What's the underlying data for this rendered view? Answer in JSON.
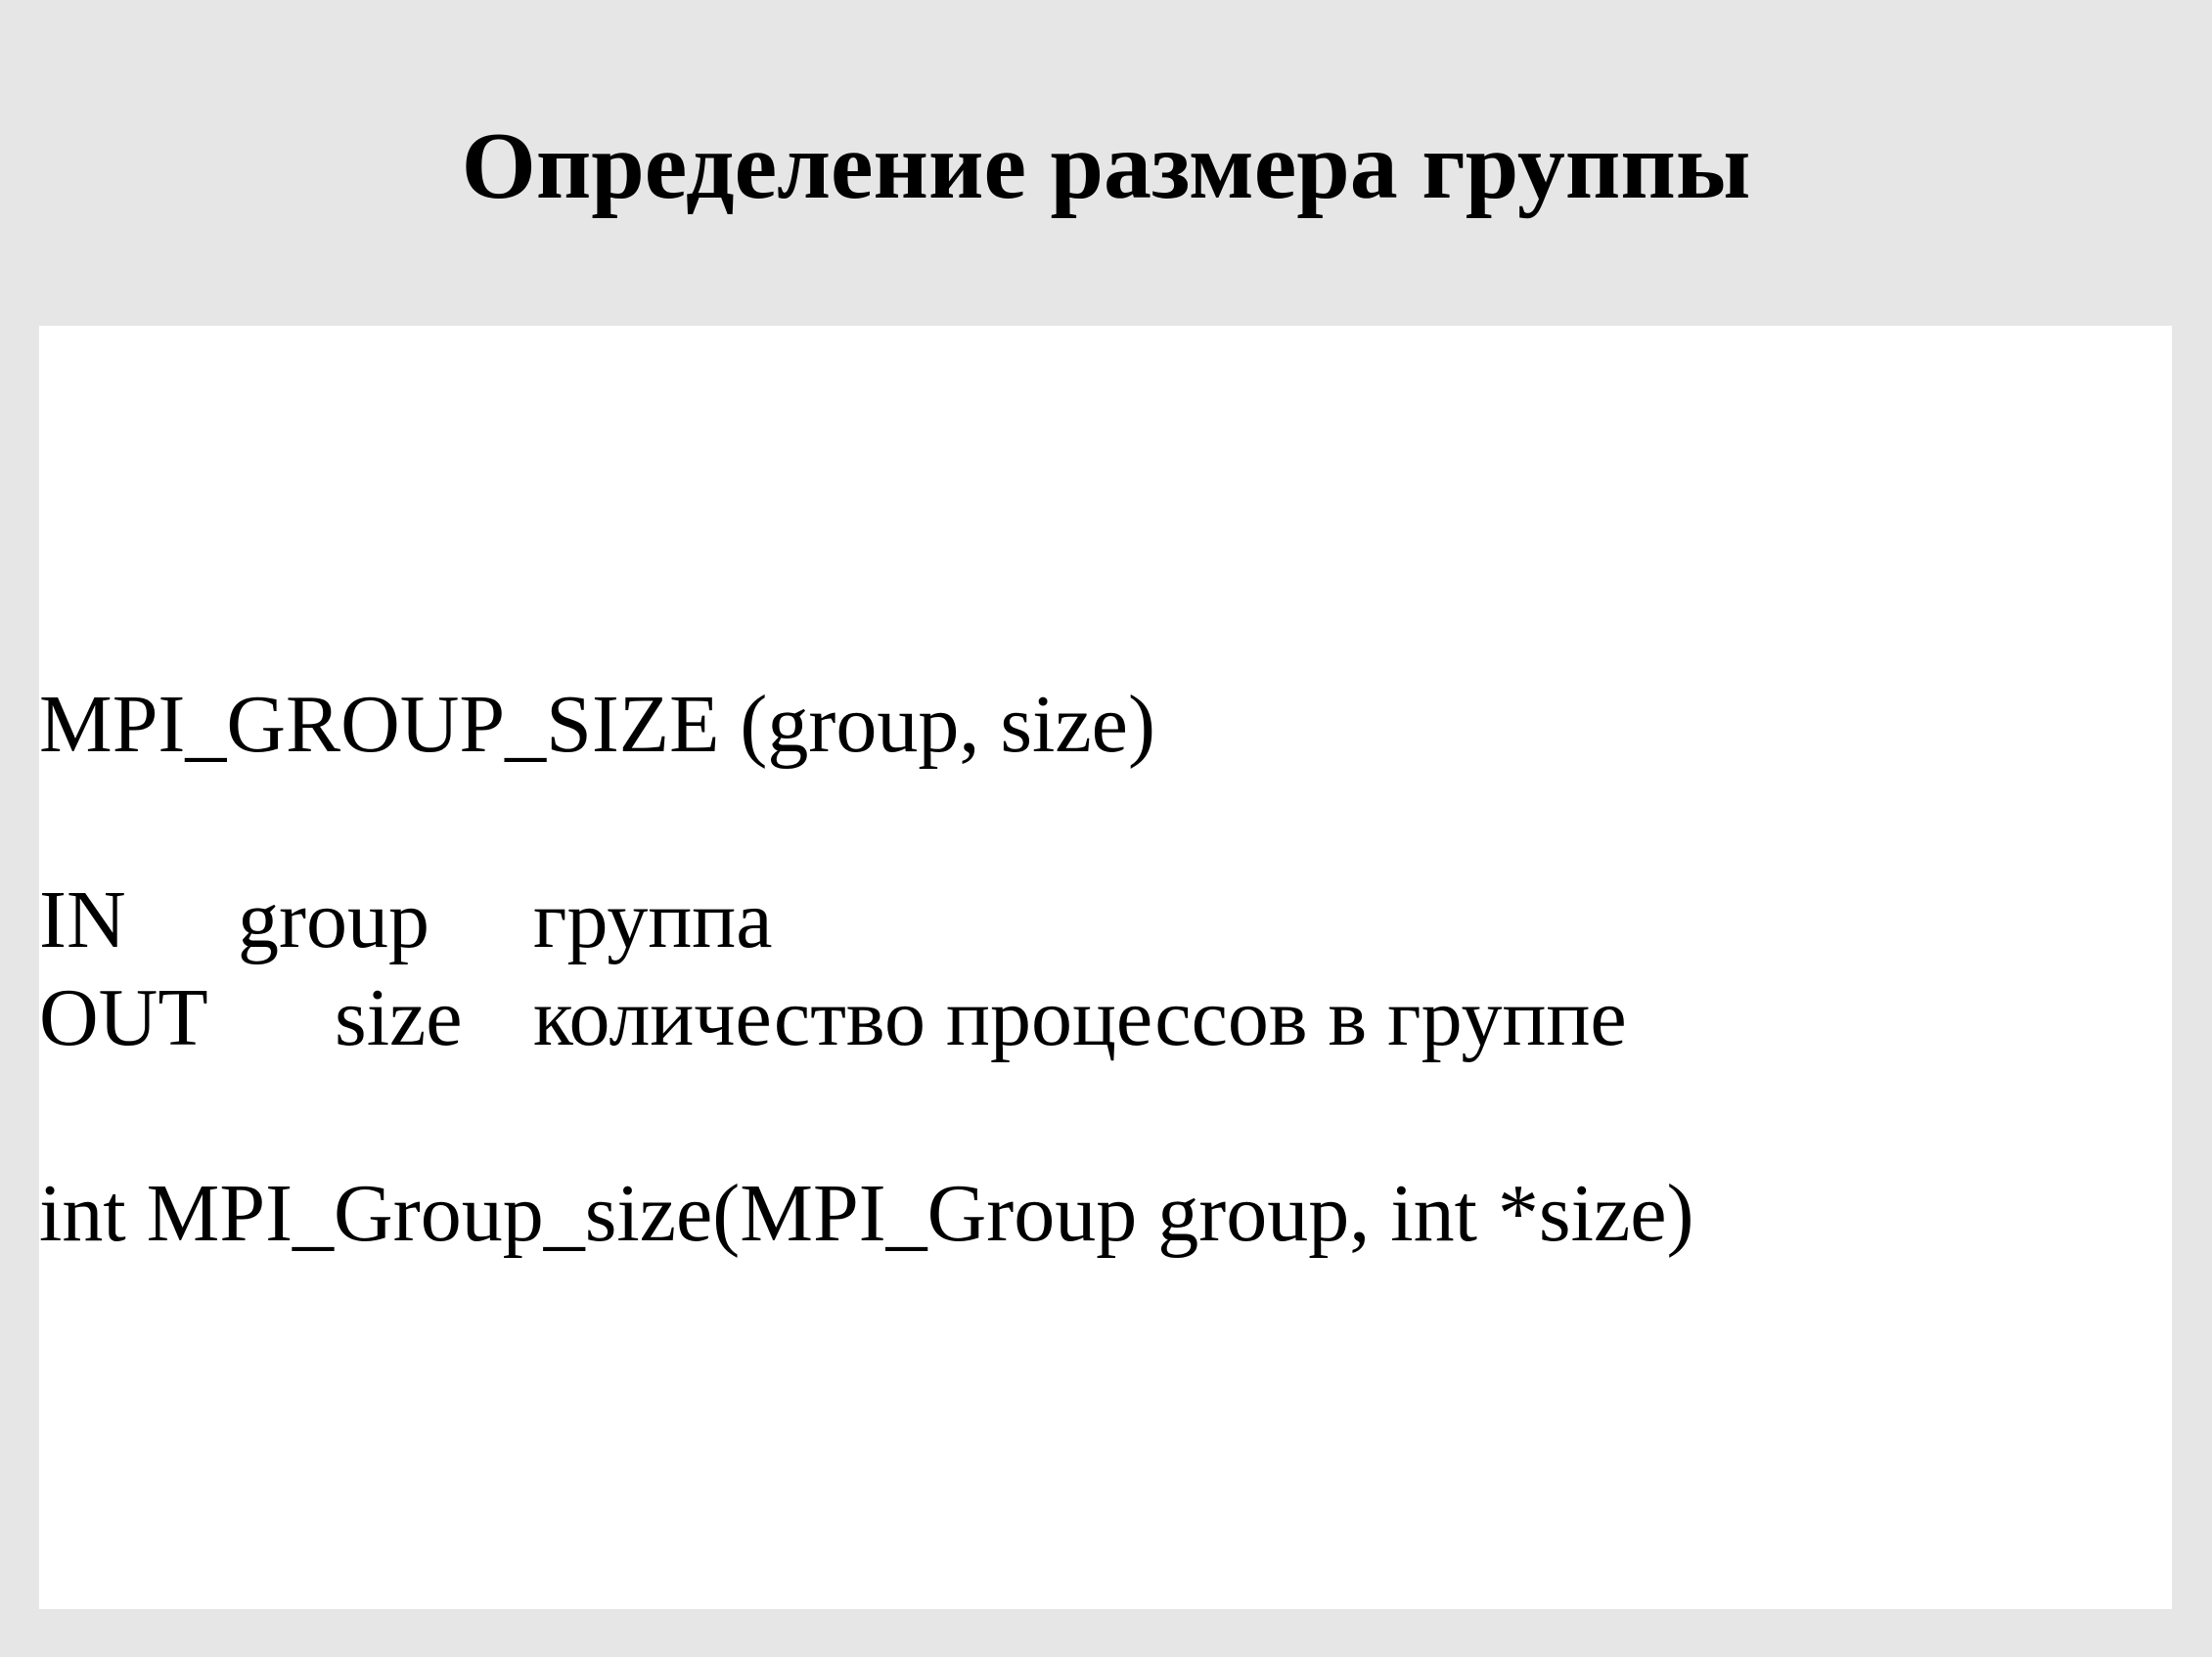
{
  "slide": {
    "title": "Определение размера группы",
    "signature": "MPI_GROUP_SIZE (group, size)",
    "params": [
      {
        "direction": "IN",
        "name": "group",
        "description": "группа"
      },
      {
        "direction": "OUT",
        "name": "size",
        "description": "количество процессов в группе"
      }
    ],
    "c_declaration": "int MPI_Group_size(MPI_Group group, int *size)"
  }
}
